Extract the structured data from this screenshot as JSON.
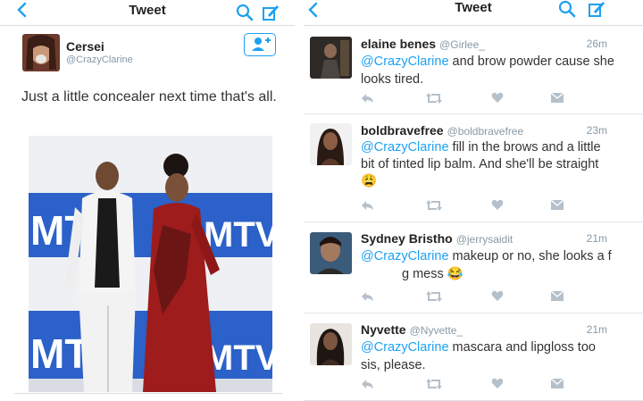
{
  "left": {
    "header": {
      "title": "Tweet"
    },
    "tweet": {
      "name": "Cersei",
      "handle": "@CrazyClarine",
      "text": "Just a little concealer next time that's all."
    },
    "photo": {
      "backdrop_text": "MTV"
    }
  },
  "right": {
    "header": {
      "title": "Tweet"
    },
    "replies": [
      {
        "name": "elaine benes",
        "handle": "@Girlee_",
        "time": "26m",
        "mention": "@CrazyClarine",
        "text": " and brow powder cause she looks tired."
      },
      {
        "name": "boldbravefree",
        "handle": "@boldbravefree",
        "time": "23m",
        "mention": "@CrazyClarine",
        "text": " fill in the brows and a little bit of tinted lip balm.  And she'll be straight ",
        "emoji": "😩"
      },
      {
        "name": "Sydney Bristho",
        "handle": "@jerrysaidit",
        "time": "21m",
        "mention": "@CrazyClarine",
        "text": " makeup or no, she looks a f",
        "text_after": "g mess ",
        "emoji": "😂"
      },
      {
        "name": "Nyvette",
        "handle": "@Nyvette_",
        "time": "21m",
        "mention": "@CrazyClarine",
        "text": " mascara and lipgloss too sis, please."
      }
    ]
  },
  "icons": [
    "back-chevron-icon",
    "search-icon",
    "compose-icon",
    "follow-icon",
    "reply-icon",
    "retweet-icon",
    "like-icon",
    "message-icon"
  ],
  "colors": {
    "accent": "#1da1f2",
    "action_gray": "#b5c0ca",
    "handle_gray": "#8899a6",
    "mtv_blue": "#2b61c9"
  }
}
